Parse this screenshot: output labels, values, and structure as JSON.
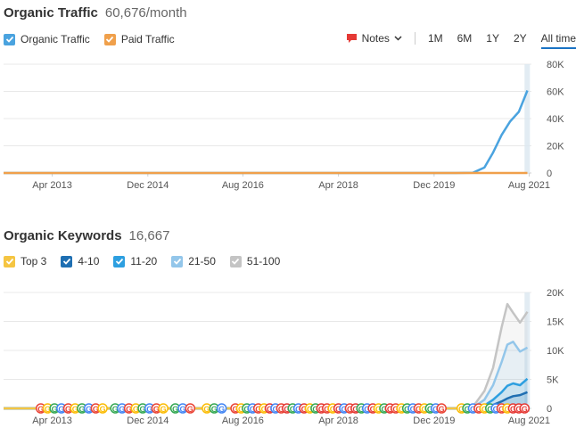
{
  "traffic": {
    "title": "Organic Traffic",
    "value": "60,676/month",
    "legend": [
      {
        "label": "Organic Traffic",
        "color": "#4aa3df"
      },
      {
        "label": "Paid Traffic",
        "color": "#f0a04b"
      }
    ],
    "notes_label": "Notes",
    "ranges": [
      "1M",
      "6M",
      "1Y",
      "2Y",
      "All time"
    ],
    "active_range": "All time"
  },
  "keywords": {
    "title": "Organic Keywords",
    "value": "16,667",
    "legend": [
      {
        "label": "Top 3",
        "color": "#f5c542"
      },
      {
        "label": "4-10",
        "color": "#1f6fb2"
      },
      {
        "label": "11-20",
        "color": "#2d9fe0"
      },
      {
        "label": "21-50",
        "color": "#93c6ea"
      },
      {
        "label": "51-100",
        "color": "#c4c4c4"
      }
    ],
    "marker_letter": "G"
  },
  "chart_data": [
    {
      "type": "line",
      "x_ticks": [
        "Apr 2013",
        "Dec 2014",
        "Aug 2016",
        "Apr 2018",
        "Dec 2019",
        "Aug 2021"
      ],
      "y_ticks": [
        "80K",
        "60K",
        "40K",
        "20K",
        "0"
      ],
      "ylim": [
        0,
        80000
      ],
      "series": [
        {
          "name": "Organic Traffic",
          "color": "#4aa3df",
          "x": [
            2012.4,
            2020.3,
            2020.6,
            2020.8,
            2020.95,
            2021.1,
            2021.25,
            2021.4,
            2021.55
          ],
          "y": [
            0,
            0,
            200,
            4000,
            15000,
            28000,
            38000,
            45000,
            60676
          ]
        },
        {
          "name": "Paid Traffic",
          "color": "#f0a04b",
          "x": [
            2012.4,
            2021.55
          ],
          "y": [
            0,
            0
          ]
        }
      ],
      "grid": true
    },
    {
      "type": "area",
      "x_ticks": [
        "Apr 2013",
        "Dec 2014",
        "Aug 2016",
        "Apr 2018",
        "Dec 2019",
        "Aug 2021"
      ],
      "y_ticks": [
        "20K",
        "15K",
        "10K",
        "5K",
        "0"
      ],
      "ylim": [
        0,
        20000
      ],
      "series": [
        {
          "name": "51-100",
          "color": "#c4c4c4",
          "x": [
            2012.4,
            2020.3,
            2020.6,
            2020.8,
            2020.95,
            2021.1,
            2021.2,
            2021.3,
            2021.42,
            2021.55
          ],
          "y": [
            0,
            0,
            300,
            3000,
            7000,
            14000,
            18000,
            16500,
            14800,
            16667
          ]
        },
        {
          "name": "21-50",
          "color": "#93c6ea",
          "x": [
            2012.4,
            2020.3,
            2020.6,
            2020.8,
            2020.95,
            2021.1,
            2021.2,
            2021.3,
            2021.42,
            2021.55
          ],
          "y": [
            0,
            0,
            150,
            1500,
            4000,
            8000,
            11000,
            11500,
            9800,
            10500
          ]
        },
        {
          "name": "11-20",
          "color": "#2d9fe0",
          "x": [
            2012.4,
            2020.3,
            2020.6,
            2020.8,
            2020.95,
            2021.1,
            2021.2,
            2021.3,
            2021.42,
            2021.55
          ],
          "y": [
            0,
            0,
            60,
            500,
            1500,
            2800,
            3900,
            4300,
            4000,
            5100
          ]
        },
        {
          "name": "4-10",
          "color": "#1f6fb2",
          "x": [
            2012.4,
            2020.3,
            2020.6,
            2020.8,
            2020.95,
            2021.1,
            2021.2,
            2021.3,
            2021.42,
            2021.55
          ],
          "y": [
            0,
            0,
            20,
            200,
            600,
            1200,
            1700,
            2100,
            2300,
            2800
          ]
        },
        {
          "name": "Top 3",
          "color": "#f5c542",
          "x": [
            2012.4,
            2021.55
          ],
          "y": [
            0,
            0
          ]
        }
      ],
      "grid": true
    }
  ]
}
